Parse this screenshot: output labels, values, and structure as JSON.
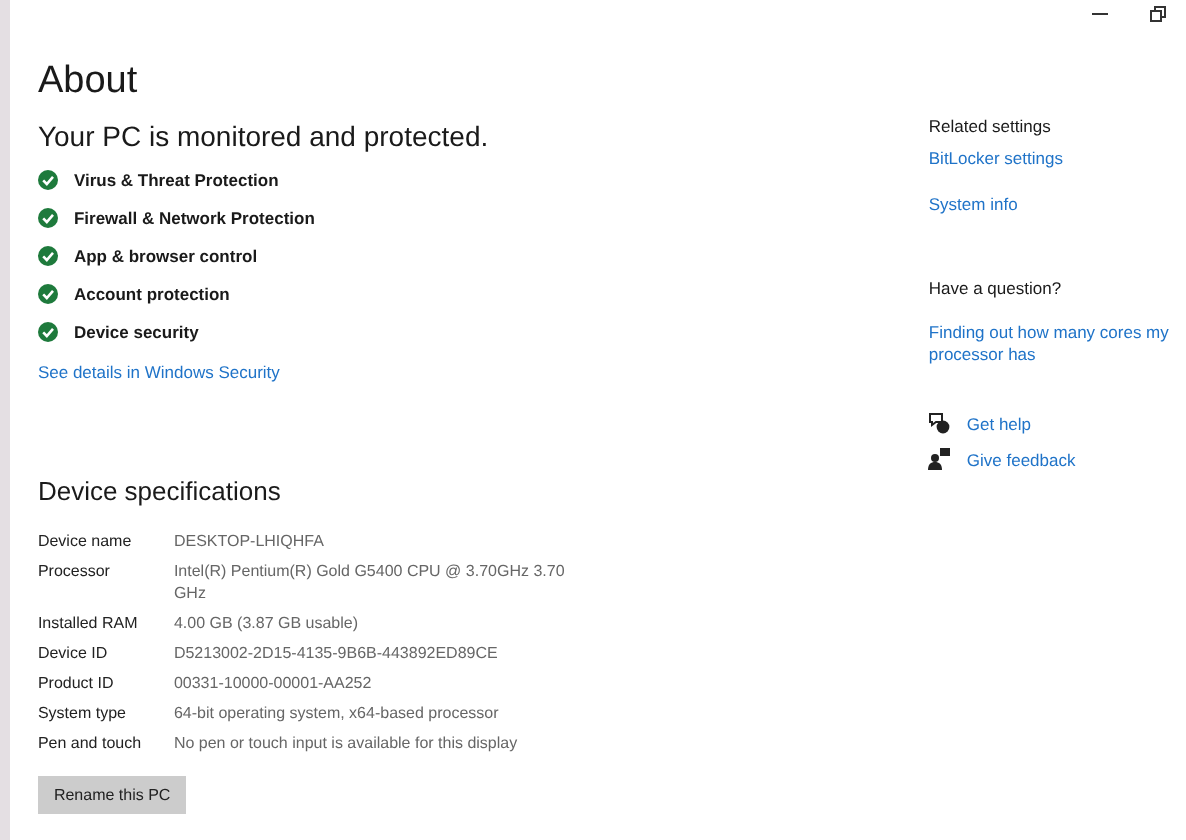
{
  "window": {
    "controls": [
      {
        "kind": "minimize"
      },
      {
        "kind": "restore"
      }
    ]
  },
  "title": "About",
  "protection": {
    "heading": "Your PC is monitored and protected.",
    "items": [
      {
        "label": "Virus & Threat Protection"
      },
      {
        "label": "Firewall & Network Protection"
      },
      {
        "label": "App & browser control"
      },
      {
        "label": "Account protection"
      },
      {
        "label": "Device security"
      }
    ],
    "link": "See details in Windows Security"
  },
  "specs": {
    "heading": "Device specifications",
    "rows": [
      {
        "name": "Device name",
        "value": "DESKTOP-LHIQHFA"
      },
      {
        "name": "Processor",
        "value": "Intel(R) Pentium(R) Gold G5400 CPU @ 3.70GHz   3.70 GHz"
      },
      {
        "name": "Installed RAM",
        "value": "4.00 GB (3.87 GB usable)"
      },
      {
        "name": "Device ID",
        "value": "D5213002-2D15-4135-9B6B-443892ED89CE"
      },
      {
        "name": "Product ID",
        "value": "00331-10000-00001-AA252"
      },
      {
        "name": "System type",
        "value": "64-bit operating system, x64-based processor"
      },
      {
        "name": "Pen and touch",
        "value": "No pen or touch input is available for this display"
      }
    ],
    "button": "Rename this PC"
  },
  "related": {
    "heading": "Related settings",
    "links": [
      "BitLocker settings",
      "System info"
    ]
  },
  "question": {
    "heading": "Have a question?",
    "link": "Finding out how many cores my processor has"
  },
  "support": [
    {
      "kind": "help",
      "label": "Get help"
    },
    {
      "kind": "feedback",
      "label": "Give feedback"
    }
  ]
}
